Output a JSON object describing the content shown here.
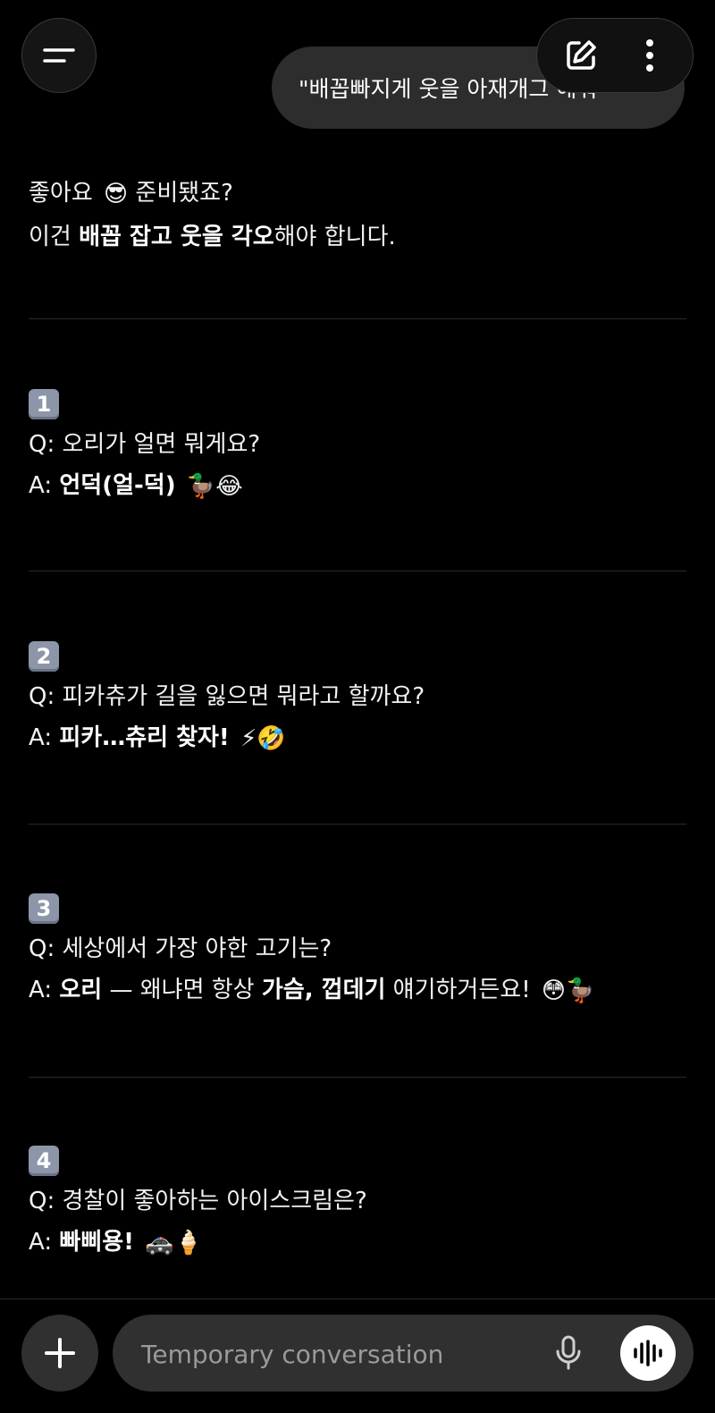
{
  "header": {
    "user_message": "\"배꼽빠지게 웃을 아재개그 해줘\""
  },
  "intro": {
    "line1_text": "좋아요",
    "line1_emoji": "😎",
    "line1_end": "준비됐죠?",
    "line2_start": "이건",
    "line2_bold": "배꼽 잡고 웃을 각오",
    "line2_end": "해야 합니다."
  },
  "jokes": [
    {
      "num": "1",
      "q": "Q: 오리가 얼면 뭐게요?",
      "a_prefix": "A:",
      "a_bold": "언덕(얼-덕)",
      "a_emoji": "🦆😂"
    },
    {
      "num": "2",
      "q": "Q: 피카츄가 길을 잃으면 뭐라고 할까요?",
      "a_prefix": "A:",
      "a_bold": "피카…츄리 찾자!",
      "a_emoji": "⚡🤣"
    },
    {
      "num": "3",
      "q": "Q: 세상에서 가장 야한 고기는?",
      "a_prefix": "A:",
      "a_bold": "오리",
      "a_mid": " — 왜냐면 항상 ",
      "a_bold2": "가슴, 껍데기",
      "a_end": " 얘기하거든요!",
      "a_emoji": "😳🦆"
    },
    {
      "num": "4",
      "q": "Q: 경찰이 좋아하는 아이스크림은?",
      "a_prefix": "A:",
      "a_bold": "빠삐용!",
      "a_emoji": "🚓🍦"
    }
  ],
  "composer": {
    "placeholder": "Temporary conversation"
  },
  "icons": {
    "menu": "menu-icon",
    "edit": "edit-icon",
    "more": "more-vertical-icon",
    "plus": "plus-icon",
    "mic": "mic-icon",
    "voice": "voice-waveform-icon"
  }
}
